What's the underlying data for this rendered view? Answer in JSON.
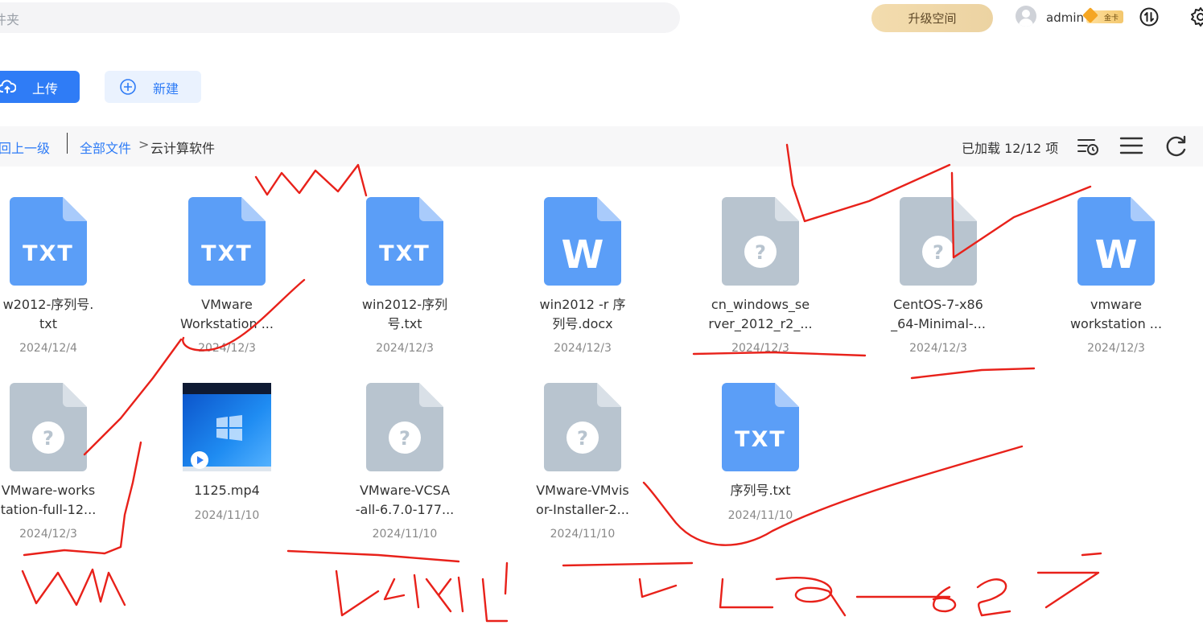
{
  "header": {
    "search_placeholder": "件夹",
    "upgrade_label": "升级空间",
    "username": "admin",
    "vip_label": "金卡"
  },
  "toolbar": {
    "upload_label": "上传",
    "new_label": "新建"
  },
  "breadcrumb": {
    "back_label": "回上一级",
    "root_label": "全部文件",
    "separator": ">",
    "current_label": "云计算软件",
    "loaded_text": "已加载 12/12 项"
  },
  "files": [
    {
      "name_line1": "w2012-序列号.",
      "name_line2": "txt",
      "date": "2024/12/4",
      "type": "txt"
    },
    {
      "name_line1": "VMware",
      "name_line2": "Workstation ...",
      "date": "2024/12/3",
      "type": "txt"
    },
    {
      "name_line1": "win2012-序列",
      "name_line2": "号.txt",
      "date": "2024/12/3",
      "type": "txt"
    },
    {
      "name_line1": "win2012 -r  序",
      "name_line2": "列号.docx",
      "date": "2024/12/3",
      "type": "word"
    },
    {
      "name_line1": "cn_windows_se",
      "name_line2": "rver_2012_r2_...",
      "date": "2024/12/3",
      "type": "unknown"
    },
    {
      "name_line1": "CentOS-7-x86",
      "name_line2": "_64-Minimal-...",
      "date": "2024/12/3",
      "type": "unknown"
    },
    {
      "name_line1": "vmware",
      "name_line2": "workstation  ...",
      "date": "2024/12/3",
      "type": "word"
    },
    {
      "name_line1": "VMware-works",
      "name_line2": "tation-full-12...",
      "date": "2024/12/3",
      "type": "unknown"
    },
    {
      "name_line1": "1125.mp4",
      "name_line2": "",
      "date": "2024/11/10",
      "type": "video"
    },
    {
      "name_line1": "VMware-VCSA",
      "name_line2": "-all-6.7.0-177...",
      "date": "2024/11/10",
      "type": "unknown"
    },
    {
      "name_line1": "VMware-VMvis",
      "name_line2": "or-Installer-2...",
      "date": "2024/11/10",
      "type": "unknown"
    },
    {
      "name_line1": "序列号.txt",
      "name_line2": "",
      "date": "2024/11/10",
      "type": "txt"
    }
  ],
  "icons": {
    "txt_label": "TXT",
    "word_label": "W",
    "unknown_label": "?",
    "txt_color": "#5b9ef7",
    "unknown_color": "#b8c4cf"
  }
}
